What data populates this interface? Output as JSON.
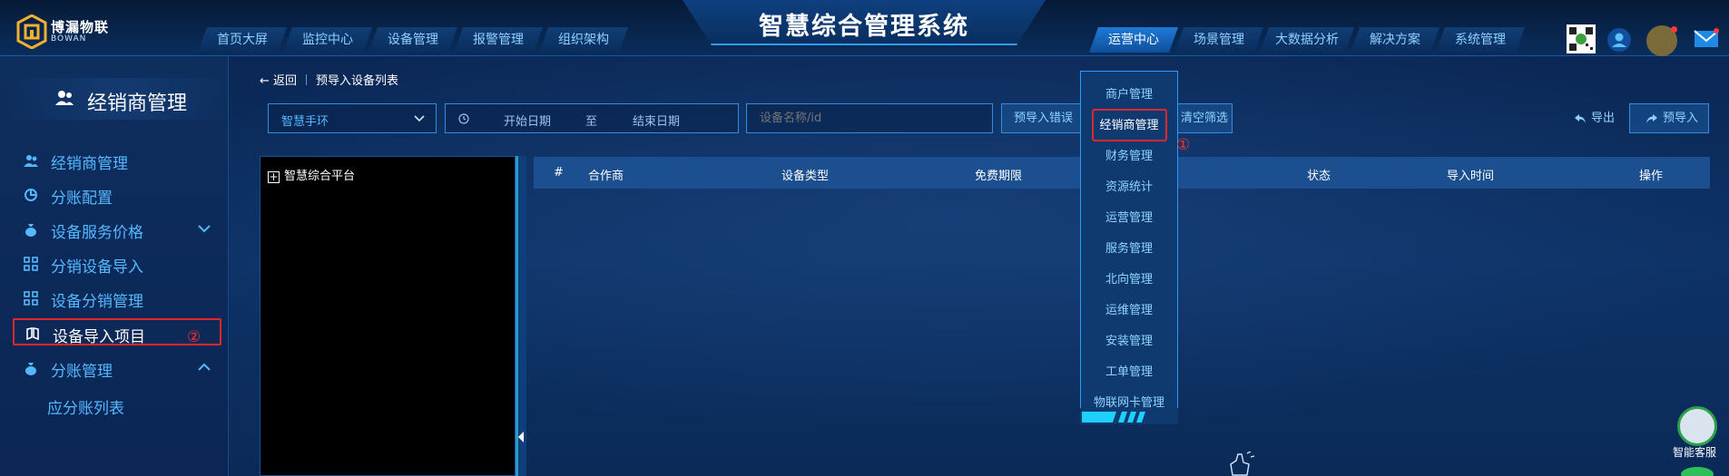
{
  "header": {
    "title": "智慧综合管理系统",
    "logo_cn": "博漏物联",
    "logo_en": "BOWAN",
    "nav_left": [
      "首页大屏",
      "监控中心",
      "设备管理",
      "报警管理",
      "组织架构"
    ],
    "nav_right": [
      "运营中心",
      "场景管理",
      "大数据分析",
      "解决方案",
      "系统管理"
    ],
    "active_nav": "运营中心"
  },
  "sidebar": {
    "title": "经销商管理",
    "items": [
      {
        "label": "经销商管理"
      },
      {
        "label": "分账配置"
      },
      {
        "label": "设备服务价格"
      },
      {
        "label": "分销设备导入"
      },
      {
        "label": "设备分销管理"
      },
      {
        "label": "设备导入项目"
      },
      {
        "label": "分账管理"
      }
    ],
    "sub_items": [
      "应分账列表"
    ]
  },
  "annotations": {
    "one": "①",
    "two": "②"
  },
  "breadcrumb": {
    "back": "← 返回",
    "current": "预导入设备列表"
  },
  "filters": {
    "platform_select": "智慧手环",
    "date_start": "开始日期",
    "date_to": "至",
    "date_end": "结束日期",
    "search_placeholder": "设备名称/id"
  },
  "buttons": {
    "import_errors": "预导入错误",
    "clear_filters": "清空筛选",
    "export": "导出",
    "pre_import": "预导入"
  },
  "tree": {
    "root": "智慧综合平台"
  },
  "table": {
    "columns": [
      "#",
      "合作商",
      "设备类型",
      "免费期限",
      "状态",
      "导入时间",
      "操作"
    ]
  },
  "dropdown": {
    "items": [
      "商户管理",
      "经销商管理",
      "财务管理",
      "资源统计",
      "运营管理",
      "服务管理",
      "北向管理",
      "运维管理",
      "安装管理",
      "工单管理",
      "物联网卡管理"
    ],
    "selected": "经销商管理"
  },
  "assistant": {
    "label": "智能客服"
  },
  "colors": {
    "accent": "#2f9bff",
    "highlight": "#e0282a",
    "link": "#55b8ff"
  }
}
